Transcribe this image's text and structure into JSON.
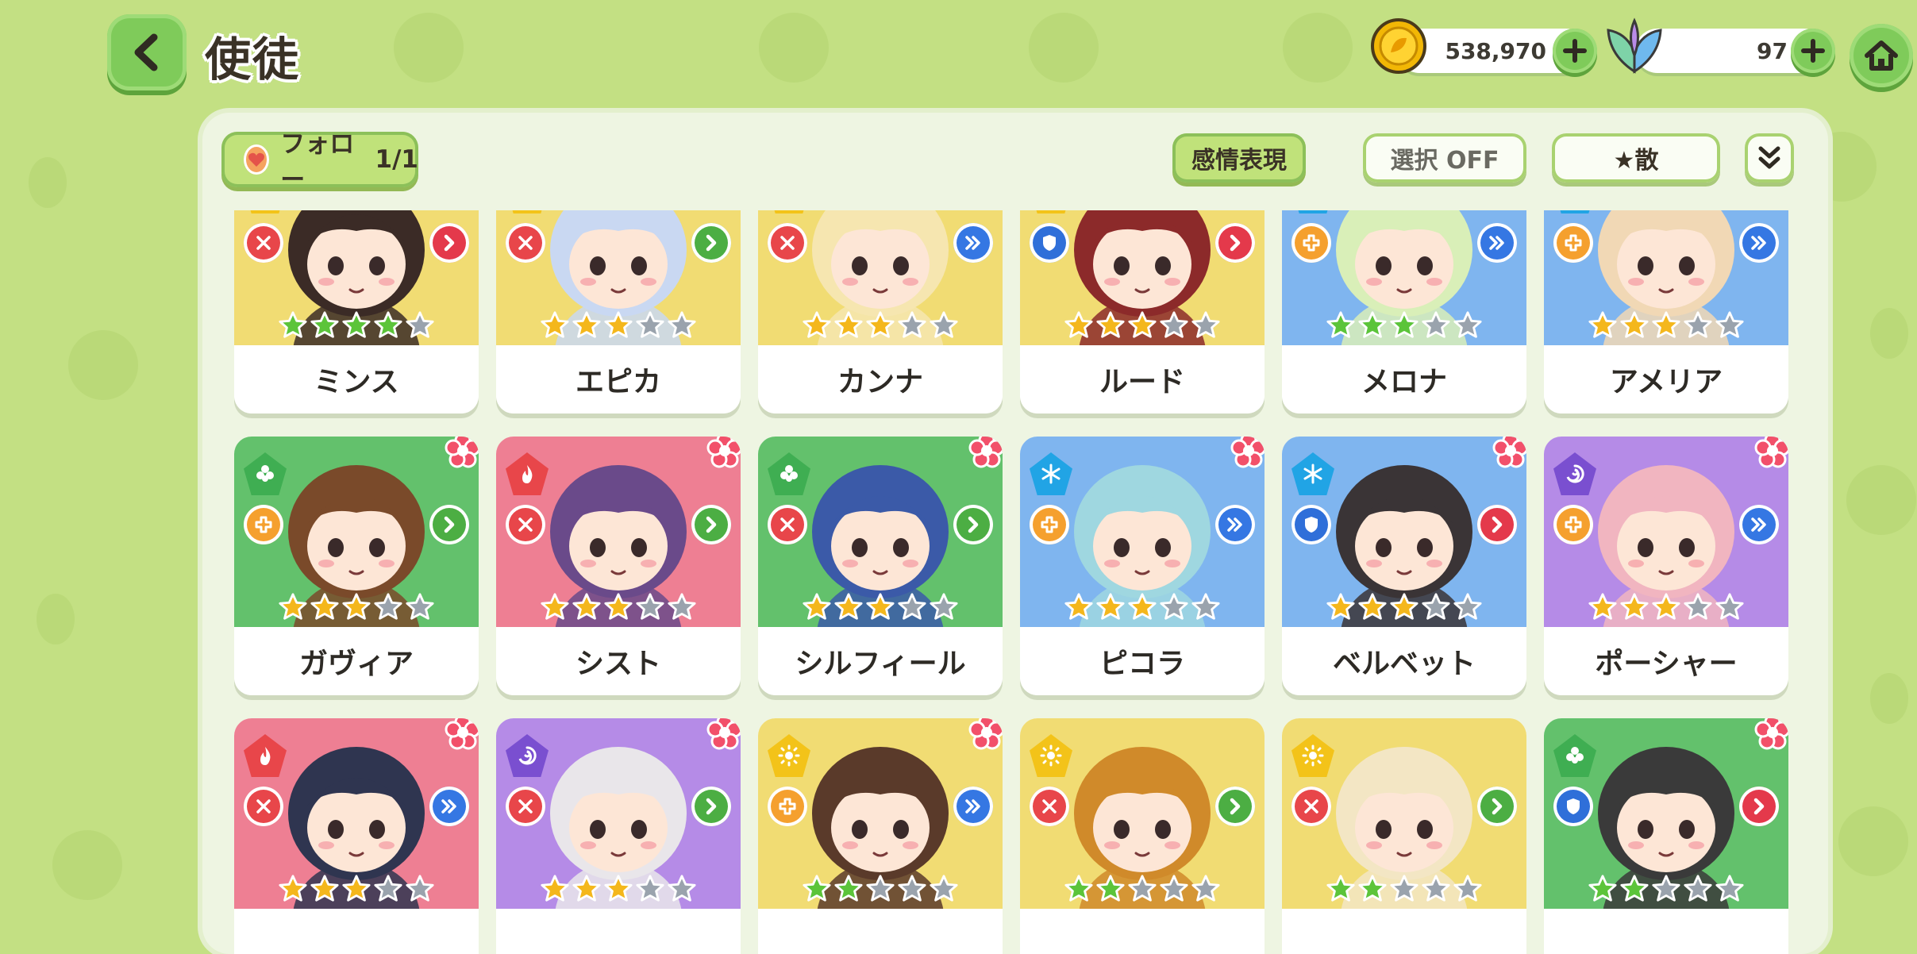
{
  "header": {
    "title": "使徒",
    "back_icon": "chevron-left-icon",
    "gold": {
      "icon": "gold-coin-icon",
      "value": "538,970"
    },
    "gem": {
      "icon": "leaf-crystal-icon",
      "value": "97"
    },
    "home_icon": "home-icon"
  },
  "toolbar": {
    "follow_label": "フォロー",
    "follow_count": "1/1",
    "emotion_label": "感情表現",
    "select_label": "選択 OFF",
    "star_sort_label": "★散",
    "expand_icon": "double-chevron-down-icon"
  },
  "colors": {
    "background": "#c3e083",
    "accent_green": "#7fcb5a",
    "yellow": "#f1dc73",
    "blue": "#7fb5ef",
    "green": "#63c16c",
    "pink": "#ee7f93",
    "purple": "#b58be7",
    "elem_light": "#f3c319",
    "elem_water": "#21a4e5",
    "elem_wood": "#3fae52",
    "elem_fire": "#e8464a",
    "elem_dark": "#7a4fd0",
    "role_attack": "#e8464a",
    "role_heal": "#f5a02e",
    "role_defense": "#2f6fd9",
    "pos_green": "#4cae43",
    "pos_red": "#e4394b",
    "pos_blue": "#3577e3"
  },
  "characters": [
    {
      "name": "ミンス",
      "bg": "yellow",
      "element": "light",
      "role": "attack",
      "position": "red",
      "stars": 4,
      "star_color": "green",
      "flower": false
    },
    {
      "name": "エピカ",
      "bg": "yellow",
      "element": "light",
      "role": "attack",
      "position": "green",
      "stars": 3,
      "star_color": "gold",
      "flower": false
    },
    {
      "name": "カンナ",
      "bg": "yellow",
      "element": "light",
      "role": "attack",
      "position": "blue",
      "stars": 3,
      "star_color": "gold",
      "flower": false
    },
    {
      "name": "ルード",
      "bg": "yellow",
      "element": "light",
      "role": "defense",
      "position": "red",
      "stars": 3,
      "star_color": "gold",
      "flower": false
    },
    {
      "name": "メロナ",
      "bg": "blue",
      "element": "water",
      "role": "heal",
      "position": "blue",
      "stars": 3,
      "star_color": "green",
      "flower": false
    },
    {
      "name": "アメリア",
      "bg": "blue",
      "element": "water",
      "role": "heal",
      "position": "blue",
      "stars": 3,
      "star_color": "gold",
      "flower": false
    },
    {
      "name": "ガヴィア",
      "bg": "green",
      "element": "wood",
      "role": "heal",
      "position": "green",
      "stars": 3,
      "star_color": "gold",
      "flower": true
    },
    {
      "name": "シスト",
      "bg": "pink",
      "element": "fire",
      "role": "attack",
      "position": "green",
      "stars": 3,
      "star_color": "gold",
      "flower": true
    },
    {
      "name": "シルフィール",
      "bg": "green",
      "element": "wood",
      "role": "attack",
      "position": "green",
      "stars": 3,
      "star_color": "gold",
      "flower": true
    },
    {
      "name": "ピコラ",
      "bg": "blue",
      "element": "water",
      "role": "heal",
      "position": "blue",
      "stars": 3,
      "star_color": "gold",
      "flower": true
    },
    {
      "name": "ベルベット",
      "bg": "blue",
      "element": "water",
      "role": "defense",
      "position": "red",
      "stars": 3,
      "star_color": "gold",
      "flower": true
    },
    {
      "name": "ポーシャー",
      "bg": "purple",
      "element": "dark",
      "role": "heal",
      "position": "blue",
      "stars": 3,
      "star_color": "gold",
      "flower": true
    },
    {
      "name": "",
      "bg": "pink",
      "element": "fire",
      "role": "attack",
      "position": "blue",
      "stars": 3,
      "star_color": "gold",
      "flower": true
    },
    {
      "name": "",
      "bg": "purple",
      "element": "dark",
      "role": "attack",
      "position": "green",
      "stars": 3,
      "star_color": "gold",
      "flower": true
    },
    {
      "name": "",
      "bg": "yellow",
      "element": "light",
      "role": "heal",
      "position": "blue",
      "stars": 2,
      "star_color": "green",
      "flower": true
    },
    {
      "name": "",
      "bg": "yellow",
      "element": "light",
      "role": "attack",
      "position": "green",
      "stars": 2,
      "star_color": "green",
      "flower": false
    },
    {
      "name": "",
      "bg": "yellow",
      "element": "light",
      "role": "attack",
      "position": "green",
      "stars": 2,
      "star_color": "green",
      "flower": false
    },
    {
      "name": "",
      "bg": "green",
      "element": "wood",
      "role": "defense",
      "position": "red",
      "stars": 2,
      "star_color": "green",
      "flower": true
    }
  ]
}
